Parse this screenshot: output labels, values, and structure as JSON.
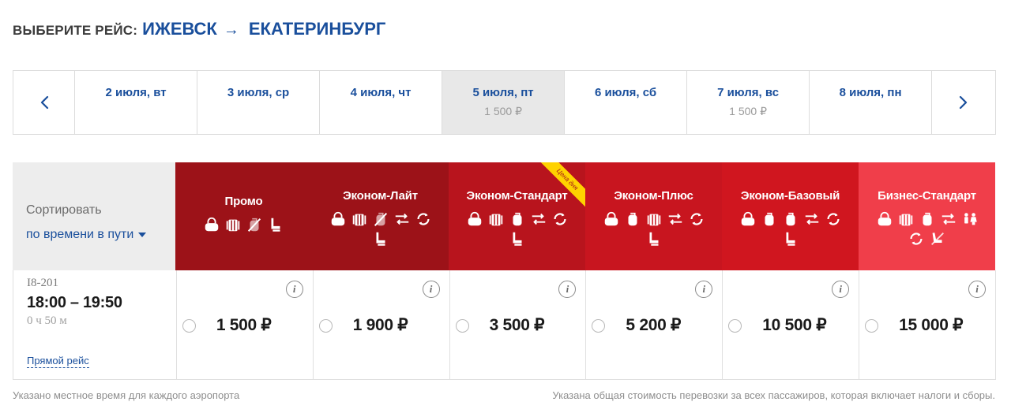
{
  "header": {
    "prefix": "ВЫБЕРИТЕ РЕЙС:",
    "origin": "ИЖЕВСК",
    "arrow": "→",
    "destination": "ЕКАТЕРИНБУРГ"
  },
  "date_strip": {
    "prev_icon": "chevron-left-icon",
    "next_icon": "chevron-right-icon",
    "selected_index": 3,
    "dates": [
      {
        "label": "2 июля, вт",
        "price": ""
      },
      {
        "label": "3 июля, ср",
        "price": ""
      },
      {
        "label": "4 июля, чт",
        "price": ""
      },
      {
        "label": "5 июля, пт",
        "price": "1 500 ₽"
      },
      {
        "label": "6 июля, сб",
        "price": ""
      },
      {
        "label": "7 июля, вс",
        "price": "1 500 ₽"
      },
      {
        "label": "8 июля, пн",
        "price": ""
      }
    ]
  },
  "sort": {
    "label": "Сортировать",
    "value": "по времени в пути"
  },
  "fares": [
    {
      "name": "Промо",
      "color": "#9c1218",
      "icons": [
        "bag-icon",
        "luggage-icon",
        "suitcase-crossed-icon",
        "seat-icon"
      ]
    },
    {
      "name": "Эконом-Лайт",
      "color": "#9c1218",
      "icons": [
        "bag-icon",
        "luggage-icon",
        "suitcase-crossed-icon",
        "exchange-icon",
        "refund-icon",
        "seat-icon"
      ]
    },
    {
      "name": "Эконом-Стандарт",
      "color": "#b8141d",
      "ribbon": "Цена дня",
      "icons": [
        "bag-icon",
        "luggage-icon",
        "suitcase-icon",
        "exchange-icon",
        "refund-icon",
        "seat-icon"
      ]
    },
    {
      "name": "Эконом-Плюс",
      "color": "#c8151f",
      "icons": [
        "bag-icon",
        "suitcase-icon",
        "luggage-icon",
        "exchange-icon",
        "refund-icon",
        "seat-icon"
      ]
    },
    {
      "name": "Эконом-Базовый",
      "color": "#d0161f",
      "icons": [
        "bag-icon",
        "suitcase-icon",
        "suitcase-icon",
        "exchange-icon",
        "refund-icon",
        "seat-icon"
      ]
    },
    {
      "name": "Бизнес-Стандарт",
      "color": "#f03e4a",
      "icons": [
        "bag-icon",
        "luggage-icon",
        "suitcase-icon",
        "exchange-icon",
        "people-icon",
        "refund-icon",
        "recline-seat-icon"
      ]
    }
  ],
  "flight": {
    "number": "I8-201",
    "time": "18:00 – 19:50",
    "duration": "0 ч 50 м",
    "type": "Прямой рейс",
    "prices": [
      "1 500 ₽",
      "1 900 ₽",
      "3 500 ₽",
      "5 200 ₽",
      "10 500 ₽",
      "15 000 ₽"
    ]
  },
  "info_glyph": "i",
  "footer": {
    "left": "Указано местное время для каждого аэропорта",
    "right": "Указана общая стоимость перевозки за всех пассажиров, которая включает налоги и сборы."
  }
}
